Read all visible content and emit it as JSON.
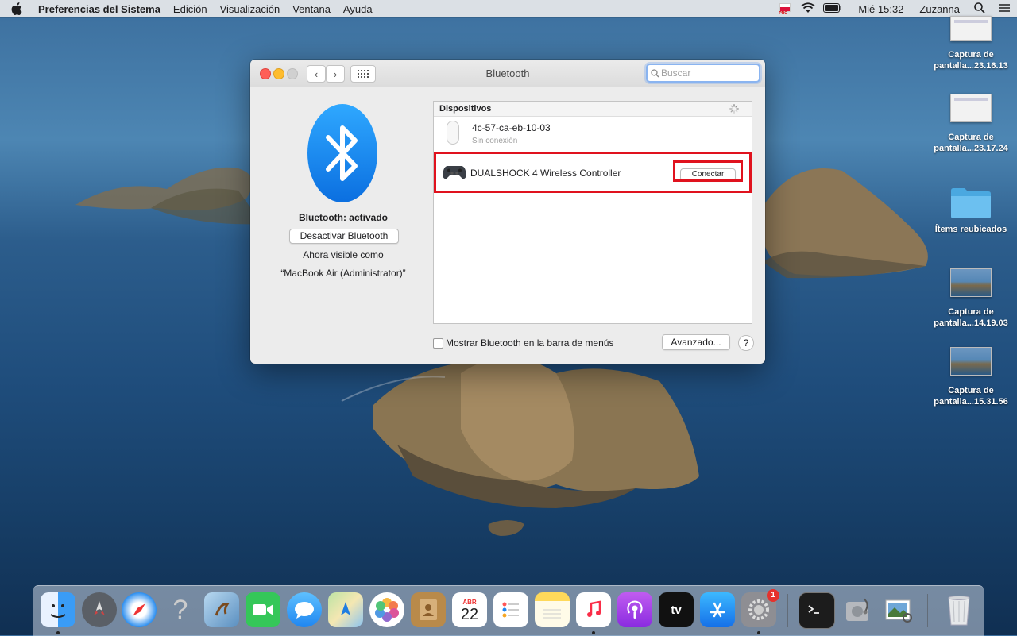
{
  "menubar": {
    "app_name": "Preferencias del Sistema",
    "items": [
      "Edición",
      "Visualización",
      "Ventana",
      "Ayuda"
    ],
    "clock": "Mié 15:32",
    "user": "Zuzanna",
    "flag_label": "PRO",
    "icons": [
      "apple-icon",
      "flag-icon",
      "wifi-icon",
      "battery-icon",
      "search-icon",
      "control-center-icon"
    ]
  },
  "desktop": {
    "icons": [
      {
        "label1": "Captura de",
        "label2": "pantalla...23.16.13"
      },
      {
        "label1": "Captura de",
        "label2": "pantalla...23.17.24"
      },
      {
        "label1": "Ítems reubicados",
        "label2": ""
      },
      {
        "label1": "Captura de",
        "label2": "pantalla...14.19.03"
      },
      {
        "label1": "Captura de",
        "label2": "pantalla...15.31.56"
      }
    ]
  },
  "window": {
    "title": "Bluetooth",
    "search_placeholder": "Buscar",
    "status": "Bluetooth: activado",
    "toggle_button": "Desactivar Bluetooth",
    "visible_as": "Ahora visible como",
    "device_name": "“MacBook Air (Administrator)”",
    "devices_header": "Dispositivos",
    "devices": [
      {
        "name": "4c-57-ca-eb-10-03",
        "status": "Sin conexión",
        "icon": "mouse-icon"
      },
      {
        "name": "DUALSHOCK 4 Wireless Controller",
        "button": "Conectar",
        "icon": "gamepad-icon"
      }
    ],
    "show_in_menubar": "Mostrar Bluetooth en la barra de menús",
    "advanced_button": "Avanzado...",
    "help": "?"
  },
  "dock": {
    "calendar_month": "ABR",
    "calendar_day": "22",
    "tv_label": "tv",
    "settings_badge": "1",
    "help_glyph": "?"
  },
  "colors": {
    "highlight": "#e0121e",
    "bluetooth_blue": "#1e8cf5"
  }
}
